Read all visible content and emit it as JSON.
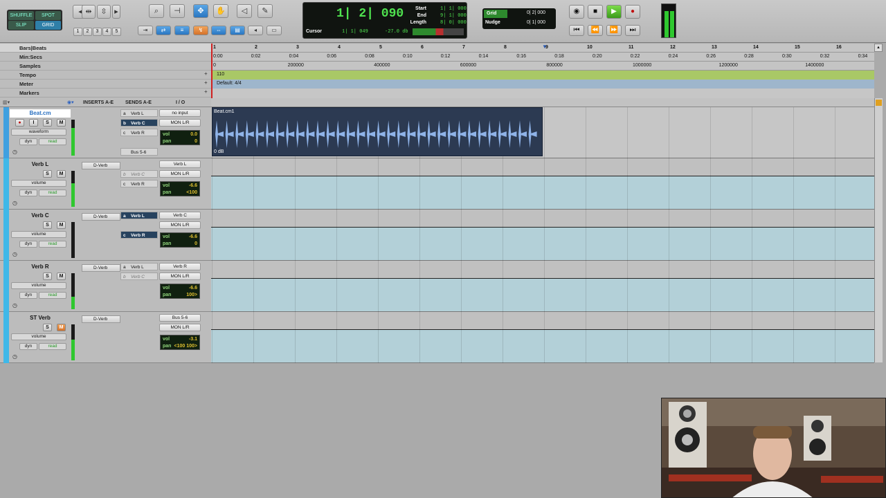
{
  "toolbar": {
    "modes": [
      "SHUFFLE",
      "SPOT",
      "SLIP",
      "GRID"
    ],
    "zoom_presets": [
      "1",
      "2",
      "3",
      "4",
      "5"
    ],
    "counter": {
      "main": "1| 2| 090",
      "start_label": "Start",
      "end_label": "End",
      "length_label": "Length",
      "start": "1| 1| 000",
      "end": "9| 1| 000",
      "length": "8| 0| 000",
      "cursor_label": "Cursor",
      "cursor": "1| 1| 049",
      "db": "-27.0 db"
    },
    "grid": {
      "grid_label": "Grid",
      "grid_value": "0| 2| 000",
      "nudge_label": "Nudge",
      "nudge_value": "0| 1| 000"
    }
  },
  "rulers": {
    "labels": [
      "Bars|Beats",
      "Min:Secs",
      "Samples",
      "Tempo",
      "Meter",
      "Markers"
    ],
    "bars": [
      "1",
      "2",
      "3",
      "4",
      "5",
      "6",
      "7",
      "8",
      "9",
      "10",
      "11",
      "12",
      "13",
      "14",
      "15",
      "16"
    ],
    "minsecs": [
      "0:00",
      "0:02",
      "0:04",
      "0:06",
      "0:08",
      "0:10",
      "0:12",
      "0:14",
      "0:16",
      "0:18",
      "0:20",
      "0:22",
      "0:24",
      "0:26",
      "0:28",
      "0:30",
      "0:32",
      "0:34"
    ],
    "samples": [
      "0",
      "200000",
      "400000",
      "600000",
      "800000",
      "1000000",
      "1200000",
      "1400000"
    ],
    "tempo_value": "110",
    "meter_value": "Default: 4/4"
  },
  "headers": {
    "inserts": "INSERTS A-E",
    "sends": "SENDS A-E",
    "io": "I / O"
  },
  "tracks": [
    {
      "name": "Beat.cm",
      "view": "waveform",
      "auto": "read",
      "auto_mode": "dyn",
      "inserts": [],
      "sends": [
        {
          "slot": "a",
          "name": "Verb L",
          "style": "normal"
        },
        {
          "slot": "b",
          "name": "Verb C",
          "style": "blue"
        },
        {
          "slot": "c",
          "name": "Verb R",
          "style": "normal"
        },
        {
          "slot": "",
          "name": "Bus 5-6",
          "style": "normal"
        }
      ],
      "input": "no input",
      "output": "MON L/R",
      "vol": "0.0",
      "pan": "0"
    },
    {
      "name": "Verb L",
      "view": "volume",
      "auto": "read",
      "auto_mode": "dyn",
      "inserts": [
        "D-Verb"
      ],
      "sends": [
        {
          "slot": "b",
          "name": "Verb C",
          "style": "dim"
        },
        {
          "slot": "c",
          "name": "Verb R",
          "style": "normal"
        }
      ],
      "input": "Verb L",
      "output": "MON L/R",
      "vol": "-6.6",
      "pan": "<100"
    },
    {
      "name": "Verb C",
      "view": "volume",
      "auto": "read",
      "auto_mode": "dyn",
      "inserts": [
        "D-Verb"
      ],
      "sends": [
        {
          "slot": "a",
          "name": "Verb L",
          "style": "blue"
        },
        {
          "slot": "c",
          "name": "Verb R",
          "style": "blue"
        }
      ],
      "input": "Verb C",
      "output": "MON L/R",
      "vol": "-6.6",
      "pan": "0"
    },
    {
      "name": "Verb R",
      "view": "volume",
      "auto": "read",
      "auto_mode": "dyn",
      "inserts": [
        "D-Verb"
      ],
      "sends": [
        {
          "slot": "a",
          "name": "Verb L",
          "style": "normal"
        },
        {
          "slot": "b",
          "name": "Verb C",
          "style": "dim"
        }
      ],
      "input": "Verb R",
      "output": "MON L/R",
      "vol": "-6.6",
      "pan": "100>"
    },
    {
      "name": "ST Verb",
      "view": "volume",
      "auto": "read",
      "auto_mode": "dyn",
      "inserts": [
        "D-Verb"
      ],
      "sends": [],
      "input": "Bus 5-6",
      "output": "MON L/R",
      "vol": "-3.1",
      "pan": "<100  100>"
    }
  ],
  "clip": {
    "name": "Beat.cm1",
    "gain": "0 dB"
  },
  "button_labels": {
    "rec": "●",
    "input": "I",
    "solo": "S",
    "mute": "M"
  },
  "vp_labels": {
    "vol": "vol",
    "pan": "pan"
  }
}
